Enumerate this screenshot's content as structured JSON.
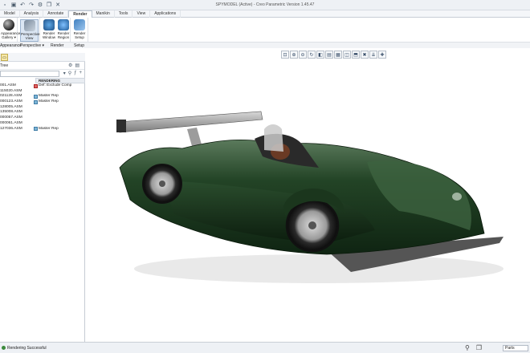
{
  "window": {
    "title": "SPYMODEL (Active) - Creo Parametric Version 1.45.47"
  },
  "qat": {
    "icons": [
      "new-icon",
      "save-icon",
      "undo-icon",
      "redo-icon",
      "regenerate-icon",
      "windows-icon",
      "close-icon"
    ]
  },
  "tabs": [
    {
      "label": "Model"
    },
    {
      "label": "Analysis"
    },
    {
      "label": "Annotate"
    },
    {
      "label": "Render"
    },
    {
      "label": "Manikin"
    },
    {
      "label": "Tools"
    },
    {
      "label": "View"
    },
    {
      "label": "Applications"
    }
  ],
  "ribbon": {
    "appearance": {
      "btn": "Appearance Gallery ▾",
      "group": "Appearance"
    },
    "perspective": {
      "btn": "Perspective View",
      "group": "Perspective ▾"
    },
    "render": {
      "btn1": "Render Window",
      "btn2": "Render Region",
      "btn3": "Render Setup",
      "group": "Render",
      "group2": "Setup"
    }
  },
  "tree": {
    "title": "Tree",
    "search_value": "",
    "column_header": "RENDERING",
    "rows": [
      {
        "name": "001.ASM",
        "rendering": "Def: Exclude Comp",
        "icon": "ex"
      },
      {
        "name": "115020.ASM",
        "rendering": "",
        "icon": ""
      },
      {
        "name": "021128.ASM",
        "rendering": "Master Rep",
        "icon": "mr"
      },
      {
        "name": "000123.ASM",
        "rendering": "Master Rep",
        "icon": "mr"
      },
      {
        "name": "128005.ASM",
        "rendering": "",
        "icon": ""
      },
      {
        "name": "135008.ASM",
        "rendering": "",
        "icon": ""
      },
      {
        "name": "000057.ASM",
        "rendering": "",
        "icon": ""
      },
      {
        "name": "000061.ASM",
        "rendering": "",
        "icon": ""
      },
      {
        "name": "127036.ASM",
        "rendering": "Master Rep",
        "icon": "mr"
      }
    ]
  },
  "status": {
    "message": "Rendering Successful",
    "filter": "Parts"
  },
  "colors": {
    "car_body": "#1f3d22",
    "accent": "#2c6aa0"
  }
}
